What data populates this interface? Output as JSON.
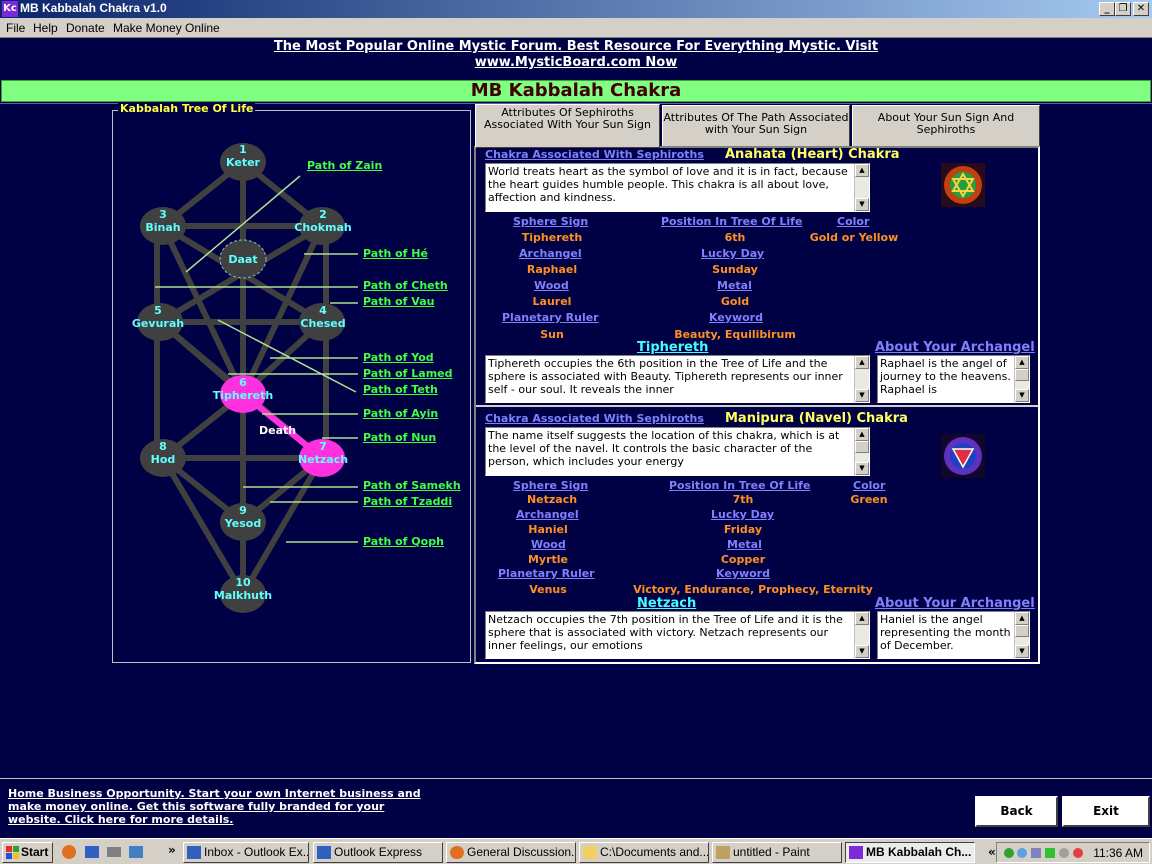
{
  "window": {
    "icon_text": "Kc",
    "title": "MB Kabbalah Chakra v1.0",
    "minimize": "_",
    "maximize": "❐",
    "close": "✕"
  },
  "menu": [
    "File",
    "Help",
    "Donate",
    "Make Money Online"
  ],
  "promo": {
    "line1": "The Most Popular Online Mystic Forum. Best Resource For Everything Mystic. Visit",
    "line2": "www.MysticBoard.com Now"
  },
  "banner_title": "MB Kabbalah Chakra",
  "tree": {
    "legend": "Kabbalah Tree Of Life",
    "death_label": "Death",
    "nodes": [
      {
        "num": "1",
        "name": "Keter"
      },
      {
        "num": "2",
        "name": "Chokmah"
      },
      {
        "num": "3",
        "name": "Binah"
      },
      {
        "num": "",
        "name": "Daat"
      },
      {
        "num": "4",
        "name": "Chesed"
      },
      {
        "num": "5",
        "name": "Gevurah"
      },
      {
        "num": "6",
        "name": "Tiphereth"
      },
      {
        "num": "7",
        "name": "Netzach"
      },
      {
        "num": "8",
        "name": "Hod"
      },
      {
        "num": "9",
        "name": "Yesod"
      },
      {
        "num": "10",
        "name": "Malkhuth"
      }
    ],
    "paths": [
      "Path of Zain",
      "Path of Hé",
      "Path of Cheth",
      "Path of Vau",
      "Path of Yod",
      "Path of Lamed",
      "Path of Teth",
      "Path of Ayin",
      "Path of Nun",
      "Path of Samekh",
      "Path of Tzaddi",
      "Path of Qoph"
    ],
    "highlight_color": "#ff30e0",
    "node_color": "#404040"
  },
  "tabs": [
    {
      "label": "Attributes Of Sephiroths Associated With Your Sun Sign",
      "active": true
    },
    {
      "label": "Attributes Of The Path Associated with Your Sun Sign",
      "active": false
    },
    {
      "label": "About Your Sun Sign And Sephiroths",
      "active": false
    }
  ],
  "field_labels": {
    "chakra_link": "Chakra Associated With Sephiroths",
    "sphere_sign": "Sphere Sign",
    "position": "Position In Tree Of Life",
    "color": "Color",
    "archangel": "Archangel",
    "lucky_day": "Lucky Day",
    "wood": "Wood",
    "metal": "Metal",
    "planetary_ruler": "Planetary Ruler",
    "keyword": "Keyword",
    "about_archangel": "About Your Archangel"
  },
  "section1": {
    "chakra_name": "Anahata (Heart) Chakra",
    "chakra_description": "World treats heart as the symbol of love and it is in fact, because the heart guides humble people. This chakra is all about love, affection and kindness.",
    "sphere_sign": "Tiphereth",
    "position": "6th",
    "color": "Gold or Yellow",
    "archangel": "Raphael",
    "lucky_day": "Sunday",
    "wood": "Laurel",
    "metal": "Gold",
    "planetary_ruler": "Sun",
    "keyword": "Beauty, Equilibirum",
    "sephira_heading": "Tiphereth",
    "sephira_description": "Tiphereth occupies the 6th position in the Tree of Life and the sphere is associated with Beauty. Tiphereth represents our inner self - our soul. It reveals the inner",
    "archangel_description": "Raphael is the angel of journey to the heavens. Raphael is"
  },
  "section2": {
    "chakra_name": "Manipura (Navel) Chakra",
    "chakra_description": "The name itself suggests the location of this chakra, which is at the level of the navel. It controls the basic character of the person, which includes your energy",
    "sphere_sign": "Netzach",
    "position": "7th",
    "color": "Green",
    "archangel": "Haniel",
    "lucky_day": "Friday",
    "wood": "Myrtle",
    "metal": "Copper",
    "planetary_ruler": "Venus",
    "keyword": "Victory, Endurance, Prophecy, Eternity",
    "sephira_heading": "Netzach",
    "sephira_description": "Netzach occupies the 7th position in the Tree of Life and it is the sphere that is associated with victory. Netzach represents our inner feelings, our emotions",
    "archangel_description": "Haniel is the angel representing the month of December."
  },
  "footer": {
    "promo": "Home Business Opportunity. Start your own Internet business and make money online. Get this software fully branded for your website. Click here for more details.",
    "back": "Back",
    "exit": "Exit"
  },
  "taskbar": {
    "start": "Start",
    "overflow": "»",
    "items": [
      {
        "label": "Inbox - Outlook Ex...",
        "icon": "mail-icon"
      },
      {
        "label": "Outlook Express",
        "icon": "mail-icon"
      },
      {
        "label": "General Discussion...",
        "icon": "browser-icon"
      },
      {
        "label": "C:\\Documents and...",
        "icon": "folder-icon"
      },
      {
        "label": "untitled - Paint",
        "icon": "paint-icon"
      },
      {
        "label": "MB Kabbalah Ch...",
        "icon": "app-icon"
      }
    ],
    "tray_chevron": "«",
    "clock": "11:36 AM"
  }
}
